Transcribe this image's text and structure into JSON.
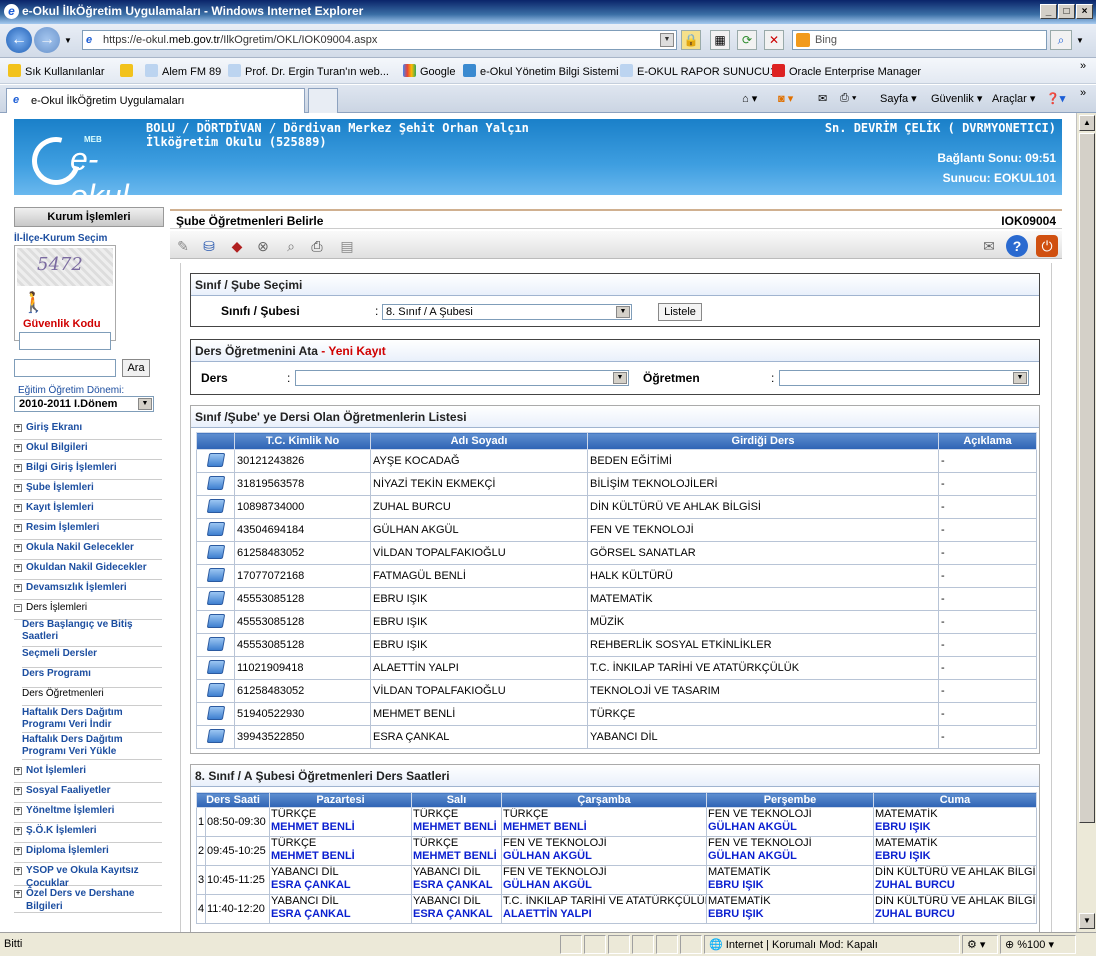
{
  "browser": {
    "title": "e-Okul İlkÖğretim Uygulamaları - Windows Internet Explorer",
    "url_prefix": "https://e-okul.",
    "url_domain": "meb.gov.tr",
    "url_suffix": "/IlkOgretim/OKL/IOK09004.aspx",
    "search_placeholder": "Bing",
    "favorites": [
      "Sık Kullanılanlar",
      "Alem FM 89",
      "Prof. Dr. Ergin Turan'ın web...",
      "Google",
      "e-Okul Yönetim Bilgi Sistemi",
      "E-OKUL RAPOR SUNUCU1",
      "Oracle Enterprise Manager"
    ],
    "tab_label": "e-Okul İlkÖğretim Uygulamaları",
    "commands": [
      "Sayfa ▾",
      "Güvenlik ▾",
      "Araçlar ▾"
    ],
    "status_text": "Bitti",
    "zone_text": "Internet | Korumalı Mod: Kapalı",
    "zoom_text": "%100"
  },
  "header": {
    "school_line1": "BOLU / DÖRTDİVAN / Dördivan Merkez Şehit Orhan Yalçın",
    "school_line2": "İlköğretim Okulu (525889)",
    "user": "Sn. DEVRİM ÇELİK ( DVRMYONETICI)",
    "connection": "Bağlantı Sonu: 09:51",
    "server": "Sunucu: EOKUL101",
    "logo_text": "e-okul",
    "logo_small": "MEB"
  },
  "sidebar": {
    "kurum_title": "Kurum İşlemleri",
    "ilce_link": "İl-İlçe-Kurum Seçim",
    "captcha_text": "5472",
    "security_label": "Güvenlik Kodu",
    "search_button": "Ara",
    "term_label": "Eğitim Öğretim Dönemi:",
    "term_value": "2010-2011 I.Dönem",
    "menu": [
      "Giriş Ekranı",
      "Okul Bilgileri",
      "Bilgi Giriş İşlemleri",
      "Şube İşlemleri",
      "Kayıt İşlemleri",
      "Resim İşlemleri",
      "Okula Nakil Gelecekler",
      "Okuldan Nakil Gidecekler",
      "Devamsızlık İşlemleri",
      "Ders İşlemleri"
    ],
    "submenu": [
      "Ders Başlangıç ve Bitiş Saatleri",
      "Seçmeli Dersler",
      "Ders Programı",
      "Ders Öğretmenleri",
      "Haftalık Ders Dağıtım Programı Veri İndir",
      "Haftalık Ders Dağıtım Programı Veri Yükle"
    ],
    "menu2": [
      "Not İşlemleri",
      "Sosyal Faaliyetler",
      "Yöneltme İşlemleri",
      "Ş.Ö.K İşlemleri",
      "Diploma İşlemleri",
      "YSOP ve Okula Kayıtsız Çocuklar",
      "Özel Ders ve Dershane Bilgileri"
    ]
  },
  "main": {
    "title": "Şube Öğretmenleri Belirle",
    "code": "IOK09004",
    "class_section": {
      "title": "Sınıf / Şube Seçimi",
      "label": "Sınıfı / Şubesi",
      "colon": ":",
      "value": "8. Sınıf / A Şubesi",
      "button": "Listele"
    },
    "assign_section": {
      "title": "Ders Öğretmenini Ata",
      "title_suffix": "- Yeni Kayıt",
      "ders_label": "Ders",
      "teacher_label": "Öğretmen",
      "colon": ":"
    },
    "teacher_list": {
      "title": "Sınıf /Şube' ye Dersi Olan Öğretmenlerin Listesi",
      "columns": [
        "T.C. Kimlik No",
        "Adı Soyadı",
        "Girdiği Ders",
        "Açıklama"
      ],
      "rows": [
        [
          "30121243826",
          "AYŞE KOCADAĞ",
          "BEDEN EĞİTİMİ",
          "-"
        ],
        [
          "31819563578",
          "NİYAZİ TEKİN EKMEKÇİ",
          "BİLİŞİM TEKNOLOJİLERİ",
          "-"
        ],
        [
          "10898734000",
          "ZUHAL BURCU",
          "DİN KÜLTÜRÜ VE AHLAK BİLGİSİ",
          "-"
        ],
        [
          "43504694184",
          "GÜLHAN AKGÜL",
          "FEN VE TEKNOLOJİ",
          "-"
        ],
        [
          "61258483052",
          "VİLDAN TOPALFAKIOĞLU",
          "GÖRSEL SANATLAR",
          "-"
        ],
        [
          "17077072168",
          "FATMAGÜL BENLİ",
          "HALK KÜLTÜRÜ",
          "-"
        ],
        [
          "45553085128",
          "EBRU IŞIK",
          "MATEMATİK",
          "-"
        ],
        [
          "45553085128",
          "EBRU IŞIK",
          "MÜZİK",
          "-"
        ],
        [
          "45553085128",
          "EBRU IŞIK",
          "REHBERLİK SOSYAL ETKİNLİKLER",
          "-"
        ],
        [
          "11021909418",
          "ALAETTİN YALPI",
          "T.C. İNKILAP TARİHİ VE ATATÜRKÇÜLÜK",
          "-"
        ],
        [
          "61258483052",
          "VİLDAN TOPALFAKIOĞLU",
          "TEKNOLOJİ VE TASARIM",
          "-"
        ],
        [
          "51940522930",
          "MEHMET BENLİ",
          "TÜRKÇE",
          "-"
        ],
        [
          "39943522850",
          "ESRA ÇANKAL",
          "YABANCI DİL",
          "-"
        ]
      ]
    },
    "schedule": {
      "title": "8. Sınıf / A Şubesi Öğretmenleri Ders Saatleri",
      "columns": [
        "Ders Saati",
        "Pazartesi",
        "Salı",
        "Çarşamba",
        "Perşembe",
        "Cuma"
      ],
      "rows": [
        {
          "n": "1",
          "time": "08:50-09:30",
          "cells": [
            [
              "TÜRKÇE",
              "MEHMET BENLİ"
            ],
            [
              "TÜRKÇE",
              "MEHMET BENLİ"
            ],
            [
              "TÜRKÇE",
              "MEHMET BENLİ"
            ],
            [
              "FEN VE TEKNOLOJİ",
              "GÜLHAN AKGÜL"
            ],
            [
              "MATEMATİK",
              "EBRU IŞIK"
            ]
          ]
        },
        {
          "n": "2",
          "time": "09:45-10:25",
          "cells": [
            [
              "TÜRKÇE",
              "MEHMET BENLİ"
            ],
            [
              "TÜRKÇE",
              "MEHMET BENLİ"
            ],
            [
              "FEN VE TEKNOLOJİ",
              "GÜLHAN AKGÜL"
            ],
            [
              "FEN VE TEKNOLOJİ",
              "GÜLHAN AKGÜL"
            ],
            [
              "MATEMATİK",
              "EBRU IŞIK"
            ]
          ]
        },
        {
          "n": "3",
          "time": "10:45-11:25",
          "cells": [
            [
              "YABANCI DİL",
              "ESRA ÇANKAL"
            ],
            [
              "YABANCI DİL",
              "ESRA ÇANKAL"
            ],
            [
              "FEN VE TEKNOLOJİ",
              "GÜLHAN AKGÜL"
            ],
            [
              "MATEMATİK",
              "EBRU IŞIK"
            ],
            [
              "DİN KÜLTÜRÜ VE AHLAK BİLGİSİ",
              "ZUHAL BURCU"
            ]
          ]
        },
        {
          "n": "4",
          "time": "11:40-12:20",
          "cells": [
            [
              "YABANCI DİL",
              "ESRA ÇANKAL"
            ],
            [
              "YABANCI DİL",
              "ESRA ÇANKAL"
            ],
            [
              "T.C. İNKILAP TARİHİ VE ATATÜRKÇÜLÜK",
              "ALAETTİN YALPI"
            ],
            [
              "MATEMATİK",
              "EBRU IŞIK"
            ],
            [
              "DİN KÜLTÜRÜ VE AHLAK BİLGİSİ",
              "ZUHAL BURCU"
            ]
          ]
        }
      ]
    }
  }
}
